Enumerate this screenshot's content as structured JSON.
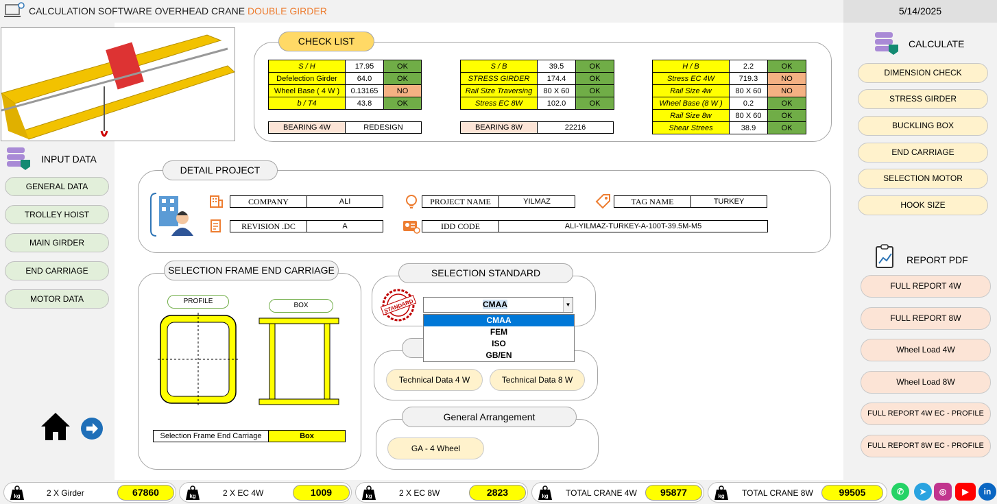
{
  "header": {
    "title_main": "CALCULATION SOFTWARE OVERHEAD CRANE",
    "title_accent": "DOUBLE GIRDER",
    "date": "5/14/2025"
  },
  "colors": {
    "accent": "#ed7d31",
    "ok": "#70ad47",
    "no": "#f4b183",
    "highlight": "#ffff00"
  },
  "input_data": {
    "title": "INPUT DATA",
    "items": [
      "GENERAL DATA",
      "TROLLEY HOIST",
      "MAIN GIRDER",
      "END CARRIAGE",
      "MOTOR DATA"
    ]
  },
  "calculate": {
    "title": "CALCULATE",
    "items": [
      "DIMENSION CHECK",
      "STRESS GIRDER",
      "BUCKLING BOX",
      "END CARRIAGE",
      "SELECTION MOTOR",
      "HOOK SIZE"
    ]
  },
  "report": {
    "title": "REPORT PDF",
    "items": [
      "FULL REPORT 4W",
      "FULL REPORT 8W",
      "Wheel Load 4W",
      "Wheel Load  8W",
      "FULL REPORT 4W  EC - PROFILE",
      "FULL REPORT 8W  EC - PROFILE"
    ]
  },
  "checklist": {
    "title": "CHECK LIST",
    "table1": [
      [
        "S / H",
        "17.95",
        "OK"
      ],
      [
        "Defelection Girder",
        "64.0",
        "OK"
      ],
      [
        "Wheel Base ( 4 W )",
        "0.13165",
        "NO"
      ],
      [
        "b / T4",
        "43.8",
        "OK"
      ]
    ],
    "table2": [
      [
        "S / B",
        "39.5",
        "OK"
      ],
      [
        "STRESS GIRDER",
        "174.4",
        "OK"
      ],
      [
        "Rail Size Traversing",
        "80 X 60",
        "OK"
      ],
      [
        "Stress EC   8W",
        "102.0",
        "OK"
      ]
    ],
    "table3": [
      [
        "H / B",
        "2.2",
        "OK"
      ],
      [
        "Stress EC   4W",
        "719.3",
        "NO"
      ],
      [
        "Rail Size 4w",
        "80 X 60",
        "NO"
      ],
      [
        "Wheel Base (8 W )",
        "0.2",
        "OK"
      ],
      [
        "Rail Size 8w",
        "80 X 60",
        "OK"
      ],
      [
        "Shear Strees",
        "38.9",
        "OK"
      ]
    ],
    "bearing4w": {
      "label": "BEARING 4W",
      "value": "REDESIGN"
    },
    "bearing8w": {
      "label": "BEARING 8W",
      "value": "22216"
    }
  },
  "detail_project": {
    "title": "DETAIL PROJECT",
    "company": {
      "label": "COMPANY",
      "value": "ALI"
    },
    "revision": {
      "label": "REVISION .DC",
      "value": "A"
    },
    "project_name": {
      "label": "PROJECT NAME",
      "value": "YILMAZ"
    },
    "idd_code": {
      "label": "IDD CODE",
      "value": "ALI-YILMAZ-TURKEY-A-100T-39.5M-M5"
    },
    "tag_name": {
      "label": "TAG NAME",
      "value": "TURKEY"
    }
  },
  "frame_ec": {
    "title": "SELECTION FRAME END CARRIAGE",
    "profile": "PROFILE",
    "box": "BOX",
    "selection_label": "Selection Frame End Carriage",
    "selection_value": "Box"
  },
  "standard": {
    "title": "SELECTION STANDARD",
    "stamp": "STANDARD",
    "selected": "CMAA",
    "options": [
      "CMAA",
      "FEM",
      "ISO",
      "GB/EN"
    ]
  },
  "technical": {
    "btn4w": "Technical Data 4 W",
    "btn8w": "Technical Data 8 W"
  },
  "general_arrangement": {
    "title": "General Arrangement",
    "btn": "GA - 4 Wheel"
  },
  "weights": [
    {
      "label": "2 X Girder",
      "value": "67860"
    },
    {
      "label": "2 X EC 4W",
      "value": "1009"
    },
    {
      "label": "2 X EC 8W",
      "value": "2823"
    },
    {
      "label": "TOTAL CRANE 4W",
      "value": "95877"
    },
    {
      "label": "TOTAL CRANE 8W",
      "value": "99505"
    }
  ],
  "kg_label": "kg",
  "social": [
    "whatsapp-icon",
    "telegram-icon",
    "instagram-icon",
    "youtube-icon",
    "linkedin-icon"
  ]
}
